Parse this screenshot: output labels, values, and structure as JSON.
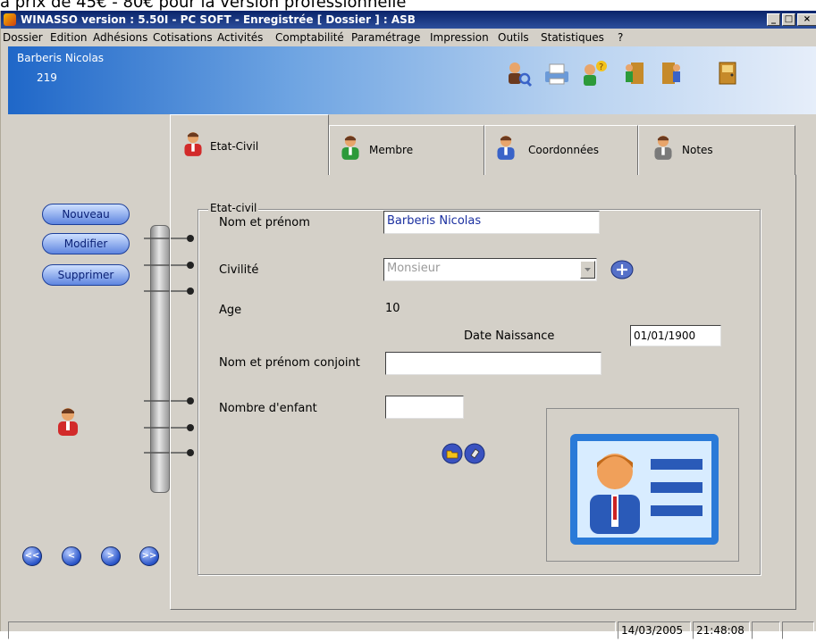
{
  "caption": "a prix de 45€ - 80€ pour la version professionnelle",
  "window": {
    "title": "WINASSO version : 5.50I - PC SOFT - Enregistrée [ Dossier ] : ASB",
    "buttons": {
      "minimize": "_",
      "maximize": "□",
      "close": "×"
    }
  },
  "menu": [
    "Dossier",
    "Edition",
    "Adhésions",
    "Cotisations",
    "Activités",
    "Comptabilité",
    "Paramétrage",
    "Impression",
    "Outils",
    "Statistiques",
    "?"
  ],
  "user": {
    "name": "Barberis Nicolas",
    "id": "219"
  },
  "toolbar_icons": [
    "search-user-icon",
    "print-icon",
    "help-user-icon",
    "exit-door-icon",
    "enter-door-icon",
    "door-icon"
  ],
  "actions": {
    "new": "Nouveau",
    "edit": "Modifier",
    "delete": "Supprimer"
  },
  "nav": {
    "first": "<<",
    "prev": "<",
    "next": ">",
    "last": ">>"
  },
  "tabs": [
    {
      "label": "Etat-Civil",
      "active": true
    },
    {
      "label": "Membre"
    },
    {
      "label": "Coordonnées"
    },
    {
      "label": "Notes"
    }
  ],
  "form": {
    "group_title": "Etat-civil",
    "name_label": "Nom et prénom",
    "name_value": "Barberis Nicolas",
    "civility_label": "Civilité",
    "civility_value": "Monsieur",
    "age_label": "Age",
    "age_value": "10",
    "birth_label": "Date Naissance",
    "birth_value": "01/01/1900",
    "spouse_label": "Nom et prénom conjoint",
    "spouse_value": "",
    "children_label": "Nombre d'enfant",
    "children_value": ""
  },
  "status": {
    "date": "14/03/2005",
    "time": "21:48:08"
  },
  "colors": {
    "title_bar": "#0a246a",
    "accent_blue": "#2a55c9",
    "name_text": "#1a2fa0",
    "background": "#d4d0c8"
  }
}
